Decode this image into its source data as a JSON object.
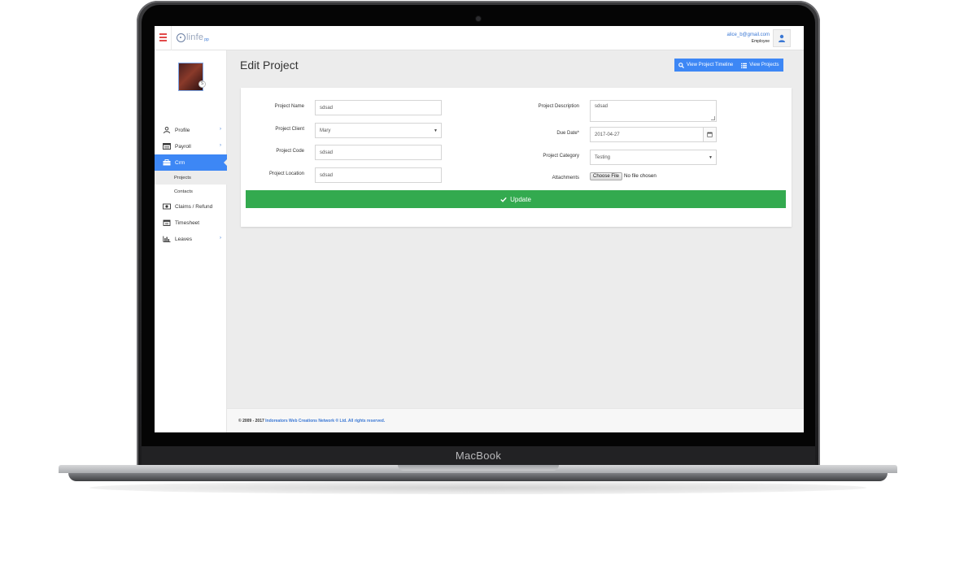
{
  "device": {
    "brand": "MacBook"
  },
  "topbar": {
    "logo_text": "linfe",
    "logo_sub": "pp",
    "user_email": "alice_b@gmail.com",
    "user_role": "Employee"
  },
  "sidebar": {
    "avatar_badge": "S",
    "items": [
      {
        "label": "Profile",
        "icon": "user-icon",
        "chevron": "›"
      },
      {
        "label": "Payroll",
        "icon": "calculator-icon",
        "chevron": "›"
      },
      {
        "label": "Crm",
        "icon": "briefcase-icon",
        "chevron": ""
      },
      {
        "label": "Claims / Refund",
        "icon": "money-icon",
        "chevron": ""
      },
      {
        "label": "Timesheet",
        "icon": "calendar-icon",
        "chevron": ""
      },
      {
        "label": "Leaves",
        "icon": "bar-chart-icon",
        "chevron": "›"
      }
    ],
    "sub_items": [
      "Projects",
      "Contacts"
    ]
  },
  "main": {
    "title": "Edit Project",
    "buttons": {
      "timeline": "View Project Timeline",
      "projects": "View Projects"
    },
    "form": {
      "project_name_label": "Project Name",
      "project_name_value": "sdsad",
      "project_client_label": "Project Client",
      "project_client_value": "Mary",
      "project_code_label": "Project Code",
      "project_code_value": "sdsad",
      "project_location_label": "Project Location",
      "project_location_value": "sdsad",
      "project_description_label": "Project Description",
      "project_description_value": "sdsad",
      "due_date_label": "Due Date*",
      "due_date_value": "2017-04-27",
      "project_category_label": "Project Category",
      "project_category_value": "Testing",
      "attachments_label": "Attachments",
      "choose_file_label": "Choose File",
      "file_status": "No file chosen",
      "update_label": "Update"
    }
  },
  "footer": {
    "prefix": "© 2009 - 2017",
    "company": "Indoreators Web Creations Network ® Ltd. All rights reserved."
  },
  "colors": {
    "accent": "#3d87f5",
    "success": "#33aa4f",
    "link": "#3b78d4"
  }
}
